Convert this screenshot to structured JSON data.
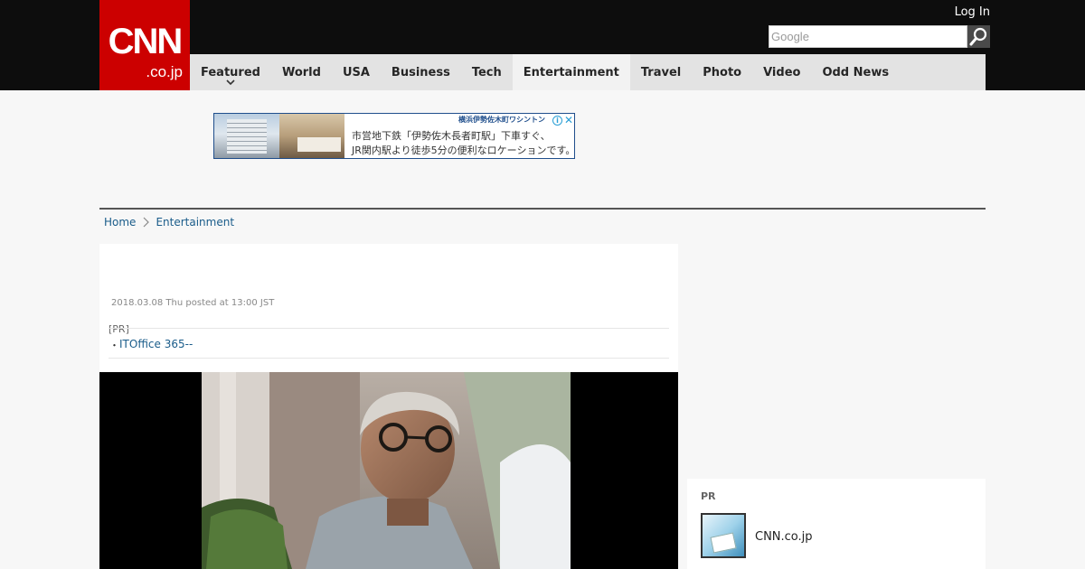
{
  "header": {
    "logo_main": "CNN",
    "logo_sub": ".co.jp",
    "login_label": "Log In",
    "search_placeholder": "Google",
    "colors": {
      "topbar": "#0d0d0d",
      "logo_red": "#cc0000",
      "nav_bg": "#e3e3e3"
    }
  },
  "nav": {
    "items": [
      {
        "label": "Featured",
        "has_dropdown": true
      },
      {
        "label": "World"
      },
      {
        "label": "USA"
      },
      {
        "label": "Business"
      },
      {
        "label": "Tech"
      },
      {
        "label": "Entertainment",
        "active": true
      },
      {
        "label": "Travel"
      },
      {
        "label": "Photo"
      },
      {
        "label": "Video"
      },
      {
        "label": "Odd News"
      }
    ]
  },
  "ad": {
    "brand": "横浜伊勢佐木町ワシントン",
    "line1": "市営地下鉄「伊勢佐木長者町駅」下車すぐ、",
    "line2": "JR関内駅より徒歩5分の便利なロケーションです。",
    "info_glyph": "i",
    "close_glyph": "✕"
  },
  "breadcrumb": {
    "items": [
      "Home",
      "Entertainment"
    ]
  },
  "article": {
    "posted": "2018.03.08 Thu posted at 13:00 JST",
    "pr_label": "[PR]",
    "pr_bullet": "・",
    "pr_link": "ITOffice 365--"
  },
  "sidebar": {
    "pr_label": "PR",
    "item_name": "CNN.co.jp"
  },
  "icons": {
    "search": "search-icon",
    "dropdown": "chevron-down-icon",
    "breadcrumb_sep": "chevron-right-icon"
  }
}
